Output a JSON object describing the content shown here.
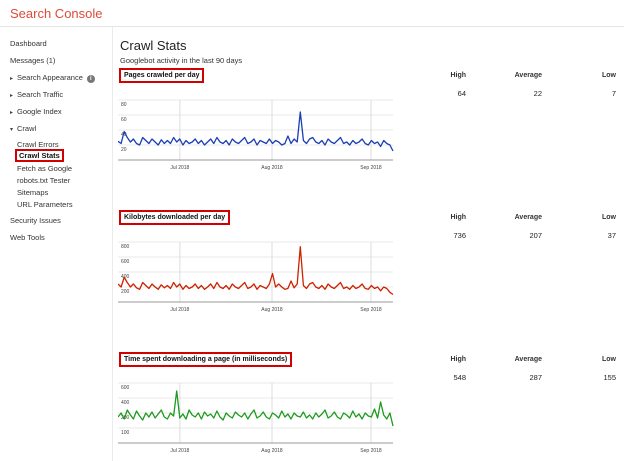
{
  "app": {
    "title": "Search Console"
  },
  "sidebar": {
    "items": [
      {
        "label": "Dashboard",
        "level": 1
      },
      {
        "label": "Messages (1)",
        "level": 1
      },
      {
        "label": "Search Appearance",
        "level": 1,
        "arrow": "right",
        "info": true
      },
      {
        "label": "Search Traffic",
        "level": 1,
        "arrow": "right"
      },
      {
        "label": "Google Index",
        "level": 1,
        "arrow": "right"
      },
      {
        "label": "Crawl",
        "level": 1,
        "arrow": "down"
      },
      {
        "label": "Crawl Errors",
        "level": 2
      },
      {
        "label": "Crawl Stats",
        "level": 2,
        "active": true
      },
      {
        "label": "Fetch as Google",
        "level": 2
      },
      {
        "label": "robots.txt Tester",
        "level": 2
      },
      {
        "label": "Sitemaps",
        "level": 2
      },
      {
        "label": "URL Parameters",
        "level": 2
      },
      {
        "label": "Security Issues",
        "level": 1
      },
      {
        "label": "Web Tools",
        "level": 1
      }
    ],
    "info_icon_glyph": "i"
  },
  "page": {
    "title": "Crawl Stats",
    "subtitle": "Googlebot activity in the last 90 days"
  },
  "stats_headers": {
    "high": "High",
    "average": "Average",
    "low": "Low"
  },
  "sections": [
    {
      "title": "Pages crawled per day",
      "high": "64",
      "average": "22",
      "low": "7",
      "color": "#1a3fb5"
    },
    {
      "title": "Kilobytes downloaded per day",
      "high": "736",
      "average": "207",
      "low": "37",
      "color": "#cc2200"
    },
    {
      "title": "Time spent downloading a page (in milliseconds)",
      "high": "548",
      "average": "287",
      "low": "155",
      "color": "#1e9a1e"
    }
  ],
  "chart_data": [
    {
      "type": "line",
      "title": "Pages crawled per day",
      "x_labels": [
        "Jul 2018",
        "Aug 2018",
        "Sep 2018"
      ],
      "y_ticks": [
        "80",
        "60",
        "40",
        "20"
      ],
      "ylim": [
        0,
        80
      ],
      "series": [
        {
          "color": "#1a3fb5",
          "values": [
            25,
            22,
            38,
            30,
            24,
            28,
            22,
            20,
            30,
            26,
            22,
            28,
            24,
            20,
            27,
            22,
            26,
            22,
            30,
            24,
            28,
            20,
            26,
            22,
            24,
            28,
            22,
            26,
            20,
            24,
            28,
            22,
            30,
            24,
            22,
            26,
            20,
            28,
            24,
            22,
            26,
            30,
            22,
            24,
            28,
            20,
            26,
            24,
            22,
            28,
            22,
            26,
            24,
            20,
            22,
            32,
            22,
            28,
            24,
            64,
            26,
            22,
            28,
            30,
            24,
            22,
            26,
            20,
            28,
            24,
            22,
            26,
            30,
            22,
            24,
            20,
            26,
            22,
            24,
            28,
            22,
            20,
            26,
            22,
            24,
            18,
            26,
            22,
            20,
            12
          ]
        }
      ]
    },
    {
      "type": "line",
      "title": "Kilobytes downloaded per day",
      "x_labels": [
        "Jul 2018",
        "Aug 2018",
        "Sep 2018"
      ],
      "y_ticks": [
        "800",
        "600",
        "400",
        "200"
      ],
      "ylim": [
        0,
        800
      ],
      "series": [
        {
          "color": "#cc2200",
          "values": [
            240,
            200,
            330,
            260,
            200,
            240,
            190,
            170,
            260,
            220,
            180,
            240,
            200,
            170,
            230,
            190,
            220,
            180,
            260,
            200,
            240,
            170,
            220,
            180,
            200,
            240,
            180,
            220,
            170,
            200,
            240,
            180,
            260,
            200,
            180,
            220,
            170,
            240,
            200,
            180,
            220,
            260,
            180,
            200,
            240,
            170,
            220,
            200,
            180,
            240,
            380,
            200,
            240,
            200,
            170,
            180,
            280,
            190,
            240,
            736,
            220,
            180,
            240,
            260,
            200,
            180,
            220,
            170,
            240,
            200,
            180,
            220,
            260,
            180,
            200,
            170,
            220,
            180,
            200,
            240,
            180,
            170,
            220,
            180,
            200,
            150,
            200,
            180,
            130,
            100
          ]
        }
      ]
    },
    {
      "type": "line",
      "title": "Time spent downloading a page (in milliseconds)",
      "x_labels": [
        "Jul 2018",
        "Aug 2018",
        "Sep 2018"
      ],
      "y_ticks": [
        "600",
        "400",
        "200",
        "100"
      ],
      "ylim": [
        0,
        600
      ],
      "series": [
        {
          "color": "#1e9a1e",
          "values": [
            260,
            300,
            240,
            330,
            280,
            240,
            320,
            270,
            230,
            300,
            260,
            310,
            250,
            290,
            330,
            260,
            240,
            300,
            270,
            520,
            250,
            290,
            240,
            330,
            280,
            260,
            300,
            240,
            310,
            270,
            290,
            250,
            320,
            260,
            230,
            300,
            270,
            250,
            310,
            280,
            260,
            300,
            240,
            290,
            330,
            250,
            270,
            310,
            260,
            240,
            300,
            280,
            250,
            320,
            260,
            290,
            240,
            300,
            270,
            260,
            310,
            250,
            280,
            240,
            300,
            260,
            290,
            330,
            250,
            270,
            310,
            260,
            240,
            300,
            280,
            250,
            320,
            260,
            290,
            240,
            300,
            270,
            260,
            340,
            250,
            410,
            280,
            240,
            300,
            170
          ]
        }
      ]
    }
  ]
}
